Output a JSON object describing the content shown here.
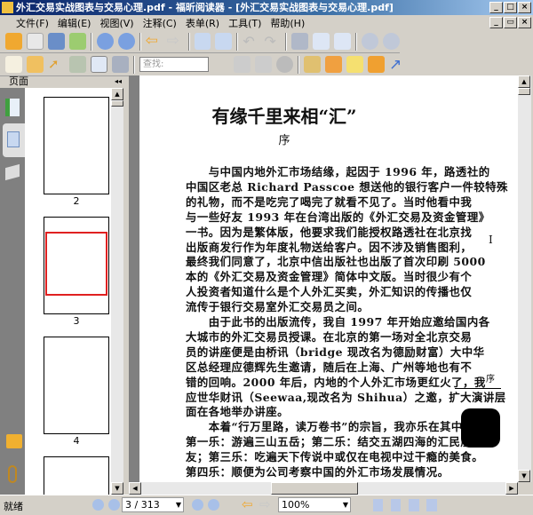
{
  "window": {
    "title": "外汇交易实战图表与交易心理.pdf - 福昕阅读器 - [外汇交易实战图表与交易心理.pdf]",
    "min": "_",
    "max": "□",
    "close": "×",
    "restore": "▭"
  },
  "menu": [
    "文件(F)",
    "编辑(E)",
    "视图(V)",
    "注释(C)",
    "表单(R)",
    "工具(T)",
    "帮助(H)"
  ],
  "toolbar": {
    "find_placeholder": "查找:"
  },
  "panel": {
    "title": "页面",
    "collapse": "◂◂",
    "thumbs": [
      "2",
      "3",
      "4"
    ]
  },
  "document": {
    "title": "有缘千里来相“汇”",
    "subtitle": "序",
    "margin_mark": "I",
    "margin_label": "序",
    "lines": [
      "　　与中国内地外汇市场结缘，起因于 1996 年，路透社的",
      "中国区老总 Richard Passcoe 想送他的银行客户一件较特殊",
      "的礼物，而不是吃完了喝完了就看不见了。当时他看中我",
      "与一些好友 1993 年在台湾出版的《外汇交易及资金管理》",
      "一书。因为是繁体版，他要求我们能授权路透社在北京找",
      "出版商发行作为年度礼物送给客户。因不涉及销售图利，",
      "最终我们同意了，北京中信出版社也出版了首次印刷 5000",
      "本的《外汇交易及资金管理》简体中文版。当时很少有个",
      "人投资者知道什么是个人外汇买卖，外汇知识的传播也仅",
      "流传于银行交易室外汇交易员之间。",
      "　　由于此书的出版流传，我自 1997 年开始应邀给国内各",
      "大城市的外汇交易员授课。在北京的第一场对全北京交易",
      "员的讲座便是由桥讯（bridge 现改名为德励财富）大中华",
      "区总经理应德辉先生邀请，随后在上海、广州等地也有不",
      "错的回响。2000 年后，内地的个人外汇市场更红火了，我",
      "应世华财讯（Seewaa,现改名为 Shihua）之邀，扩大演讲层",
      "面在各地举办讲座。",
      "　　本着“行万里路，读万卷书”的宗旨，我亦乐在其中。",
      "第一乐：游遍三山五岳；第二乐：结交五湖四海的汇民朋",
      "友；第三乐：吃遍天下传说中或仅在电视中过干瘾的美食。",
      "第四乐：顺便为公司考察中国的外汇市场发展情况。"
    ]
  },
  "status": {
    "ready": "就绪",
    "page": "3 / 313",
    "zoom": "100%"
  },
  "colors": {
    "title_start": "#0a246a",
    "highlight": "#e02020"
  }
}
